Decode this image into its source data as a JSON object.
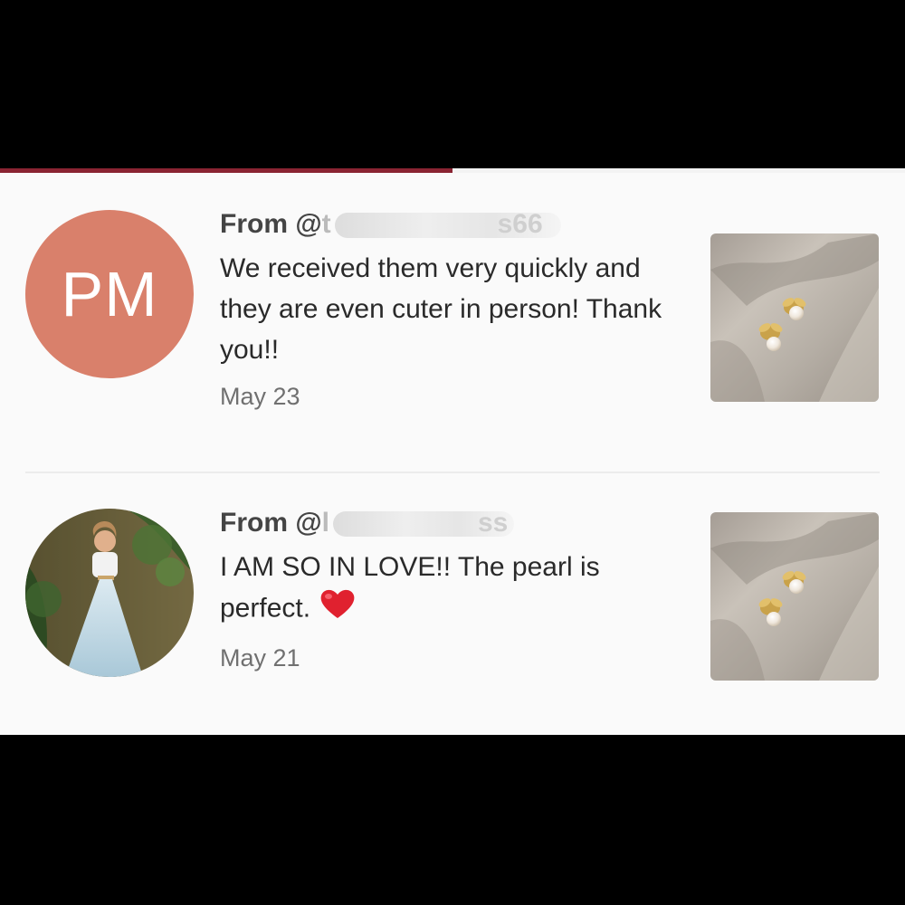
{
  "progress": {
    "fraction": 0.5,
    "color": "#8a2432"
  },
  "reviews": [
    {
      "avatar_initials": "PM",
      "avatar_color": "#d9806b",
      "from_prefix": "From @",
      "handle_visible_start": "t",
      "handle_visible_end": "s66",
      "message": "We received them very quickly and they are even cuter in person! Thank you!!",
      "date": "May 23",
      "product_image": "pearl-bee-earrings-thumbnail"
    },
    {
      "avatar_image": "profile-photo-woman-in-garden",
      "from_prefix": "From @",
      "handle_visible_start": "l",
      "handle_visible_end": "ss",
      "message": "I AM SO IN LOVE!! The pearl is perfect.",
      "date": "May 21",
      "emoji": "heart-emoji",
      "product_image": "pearl-bee-earrings-thumbnail"
    }
  ]
}
